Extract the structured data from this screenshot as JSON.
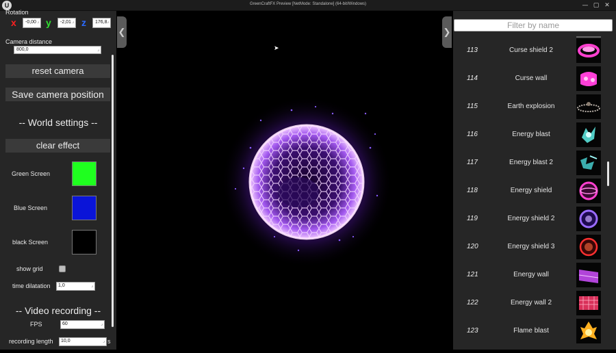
{
  "window": {
    "title": "GreenCraftFX Preview [NetMode: Standalone]  (64-bit/Windows)",
    "logo": "U",
    "buttons": [
      "—",
      "▢",
      "✕"
    ]
  },
  "left_panel": {
    "rotation_label": "Rotation",
    "rotation": [
      {
        "axis": "x",
        "value": "-0,00",
        "color": "#ff2020"
      },
      {
        "axis": "y",
        "value": "-2,01",
        "color": "#30e030"
      },
      {
        "axis": "z",
        "value": "176,8",
        "color": "#2b6bff"
      }
    ],
    "camera_distance_label": "Camera distance",
    "camera_distance": "800,0",
    "reset_camera": "reset camera",
    "save_camera": "Save camera position",
    "world_settings": "-- World settings --",
    "clear_effect": "clear effect",
    "screens": [
      {
        "label": "Green Screen",
        "color": "#1fff1f"
      },
      {
        "label": "Blue Screen",
        "color": "#0a14d8"
      },
      {
        "label": "black Screen",
        "color": "#000000"
      }
    ],
    "show_grid": "show grid",
    "time_dilatation_label": "time dilatation",
    "time_dilatation": "1,0",
    "video_recording": "-- Video recording --",
    "fps_label": "FPS",
    "fps": "60",
    "recording_length_label": "recording length",
    "recording_length": "10,0",
    "recording_length_unit": "s"
  },
  "right_panel": {
    "filter_placeholder": "Filter by name",
    "effects": [
      {
        "num": "113",
        "name": "Curse shield 2",
        "thumb": "#ff3fcf"
      },
      {
        "num": "114",
        "name": "Curse wall",
        "thumb": "#ff40d8"
      },
      {
        "num": "115",
        "name": "Earth explosion",
        "thumb": "#b8b0a8"
      },
      {
        "num": "116",
        "name": "Energy blast",
        "thumb": "#5ff0e8"
      },
      {
        "num": "117",
        "name": "Energy blast 2",
        "thumb": "#4ad8d8"
      },
      {
        "num": "118",
        "name": "Energy shield",
        "thumb": "#ff3fd0"
      },
      {
        "num": "119",
        "name": "Energy shield 2",
        "thumb": "#9a6bff"
      },
      {
        "num": "120",
        "name": "Energy shield 3",
        "thumb": "#ff3030"
      },
      {
        "num": "121",
        "name": "Energy wall",
        "thumb": "#d050ff"
      },
      {
        "num": "122",
        "name": "Energy wall 2",
        "thumb": "#ff3a6a"
      },
      {
        "num": "123",
        "name": "Flame blast",
        "thumb": "#ffb020"
      }
    ]
  },
  "preview": {
    "effect_color": "#d080ff",
    "glow_color": "#7b2bff"
  }
}
